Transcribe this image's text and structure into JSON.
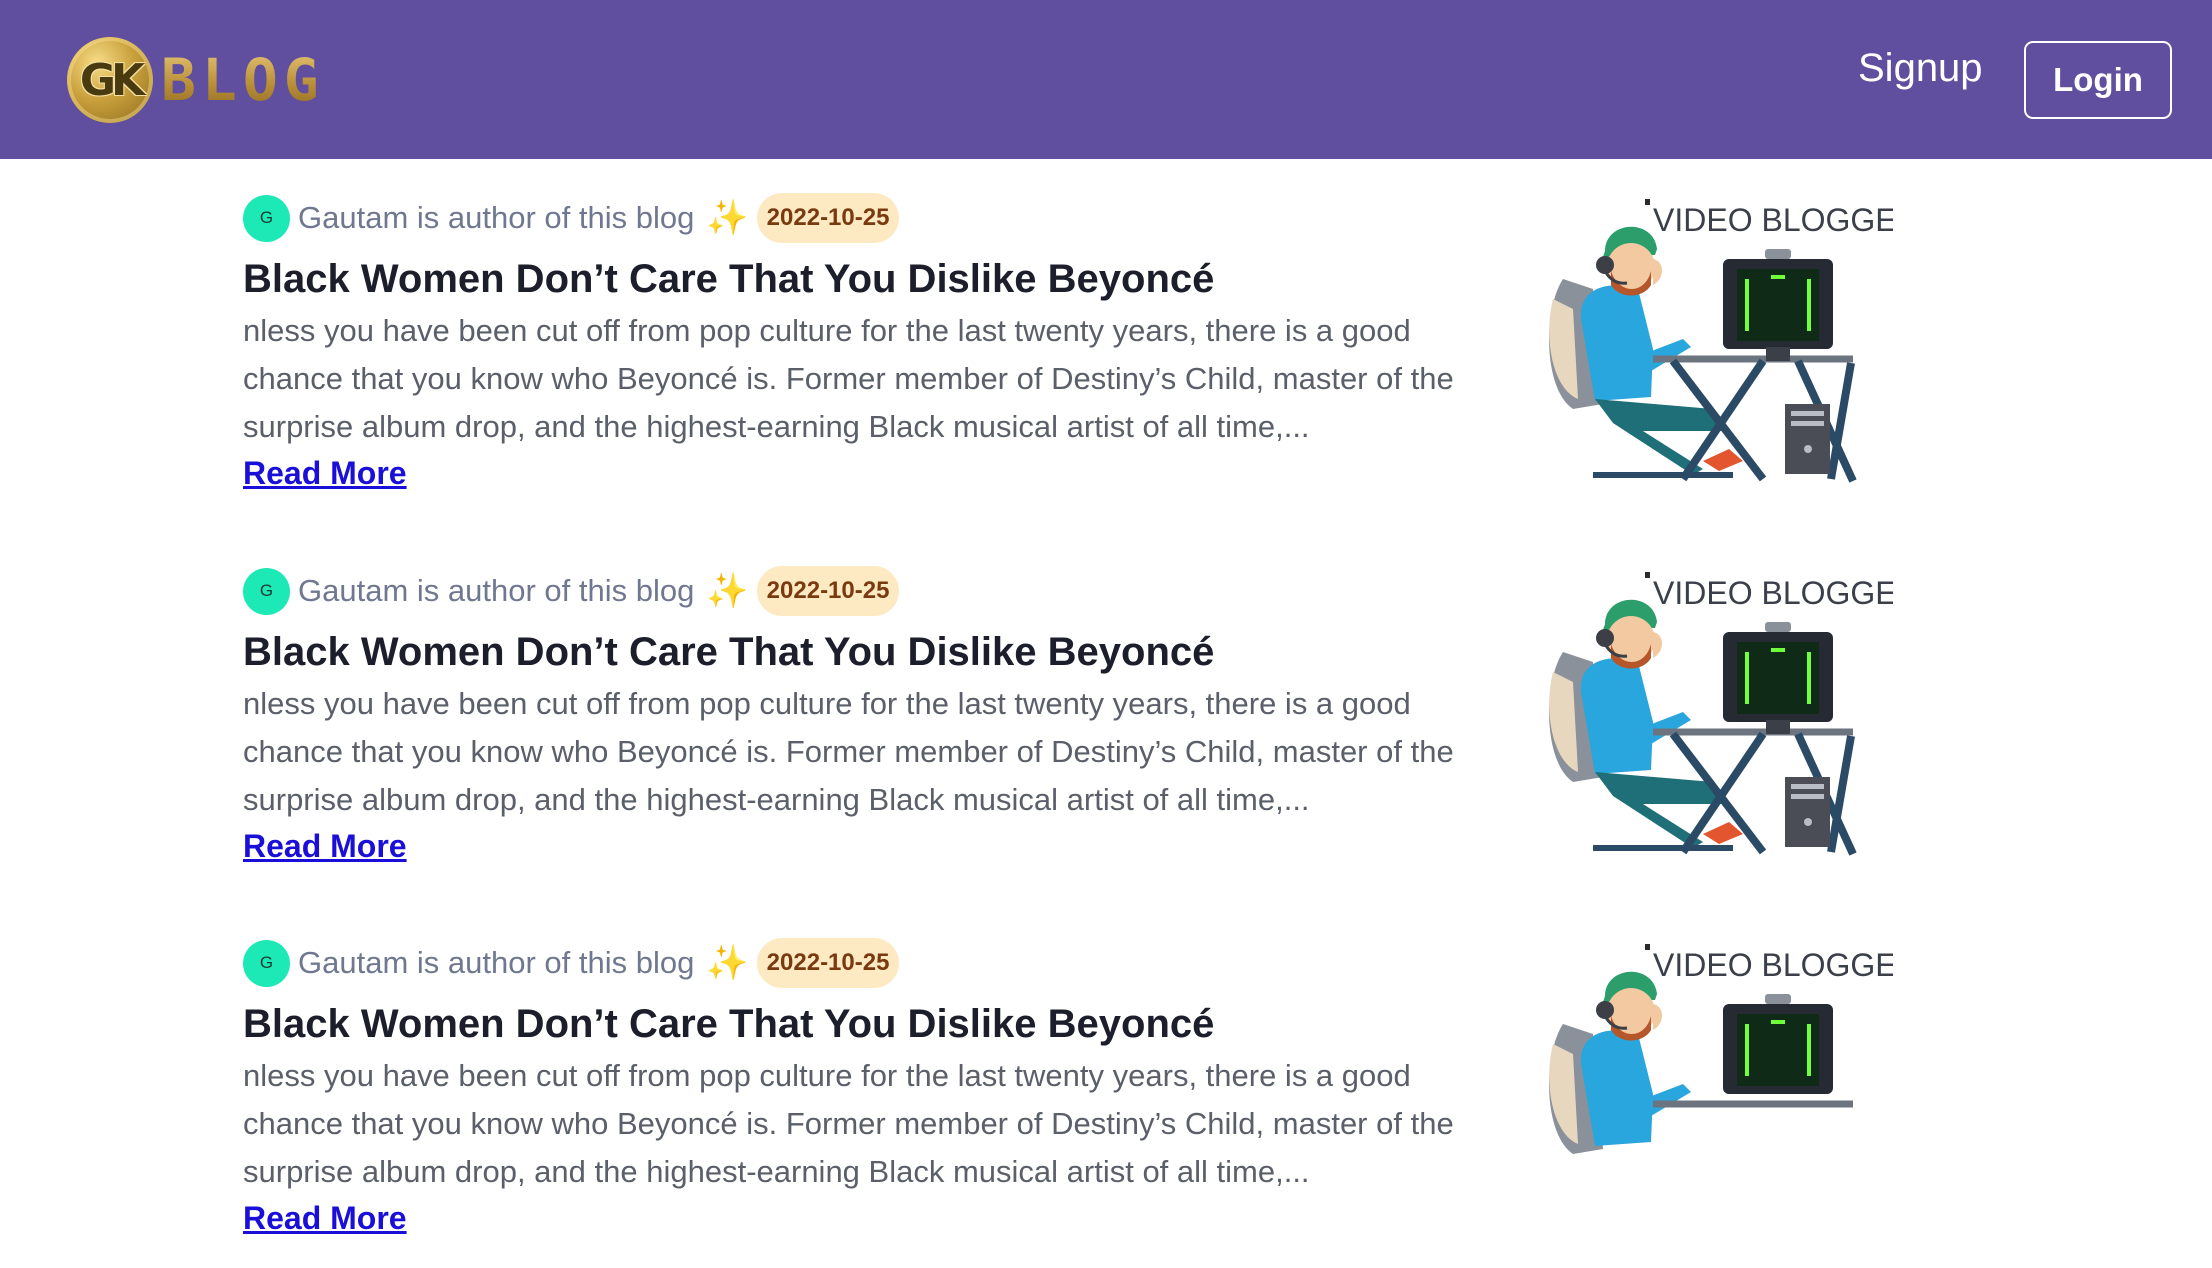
{
  "navbar": {
    "logo_badge": "GK",
    "logo_text": "BLOG",
    "signup_label": "Signup",
    "login_label": "Login",
    "background": "#604e9e"
  },
  "posts": [
    {
      "avatar_letter": "G",
      "author_text": "Gautam is author of this blog",
      "sparkle_icon": "sparkles-icon",
      "date": "2022-10-25",
      "title": "Black Women Don’t Care That You Dislike Beyoncé",
      "excerpt": "nless you have been cut off from pop culture for the last twenty years, there is a good chance that you know who Beyoncé is. Former member of Destiny’s Child, master of the surprise album drop, and the highest-earning Black musical artist of all time,...",
      "read_more": "Read More",
      "thumb_caption": "VIDEO BLOGGER"
    },
    {
      "avatar_letter": "G",
      "author_text": "Gautam is author of this blog",
      "sparkle_icon": "sparkles-icon",
      "date": "2022-10-25",
      "title": "Black Women Don’t Care That You Dislike Beyoncé",
      "excerpt": "nless you have been cut off from pop culture for the last twenty years, there is a good chance that you know who Beyoncé is. Former member of Destiny’s Child, master of the surprise album drop, and the highest-earning Black musical artist of all time,...",
      "read_more": "Read More",
      "thumb_caption": "VIDEO BLOGGER"
    },
    {
      "avatar_letter": "G",
      "author_text": "Gautam is author of this blog",
      "sparkle_icon": "sparkles-icon",
      "date": "2022-10-25",
      "title": "Black Women Don’t Care That You Dislike Beyoncé",
      "excerpt": "nless you have been cut off from pop culture for the last twenty years, there is a good chance that you know who Beyoncé is. Former member of Destiny’s Child, master of the surprise album drop, and the highest-earning Black musical artist of all time,...",
      "read_more": "Read More",
      "thumb_caption": "VIDEO BLOGGER"
    }
  ]
}
